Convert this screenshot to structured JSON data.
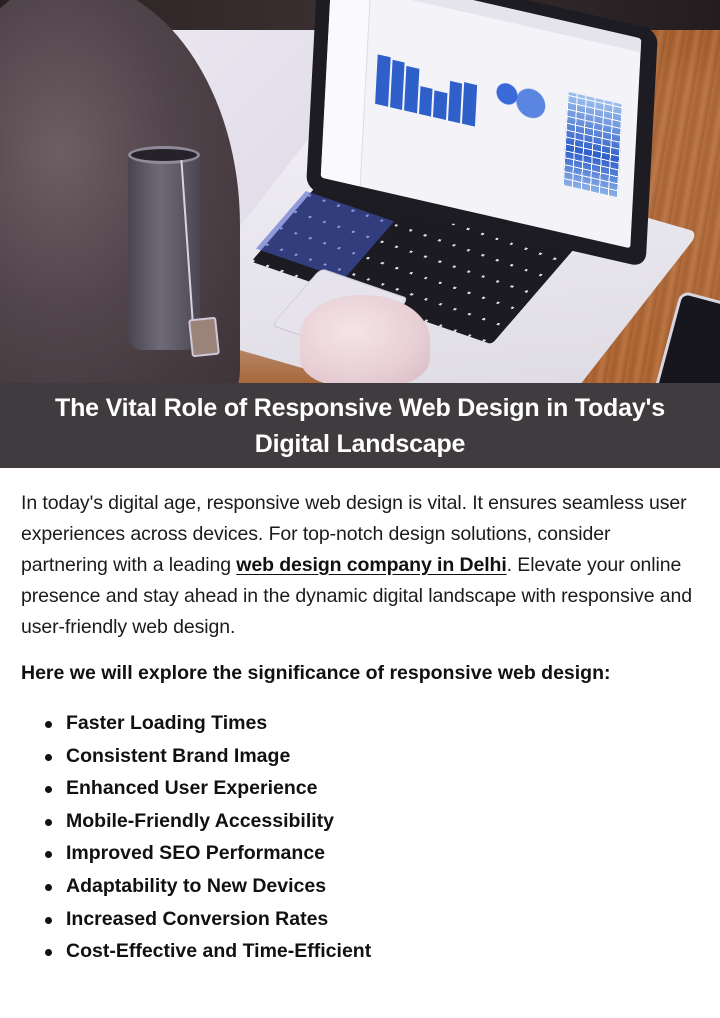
{
  "hero_image": {
    "alt": "Person using a laptop showing an analytics dashboard on a wooden desk, with a mug and a phone",
    "colors": {
      "accent_blue": "#2f5fc9",
      "desk_wood": "#a45e2e"
    }
  },
  "banner": {
    "title": "The Vital Role of Responsive Web Design in Today's Digital Landscape",
    "background": "#403b3e",
    "text_color": "#ffffff"
  },
  "intro": {
    "text_before_link": "In today's digital age, responsive web design is vital. It ensures seamless user experiences across devices. For top-notch design solutions, consider partnering with a leading ",
    "link_text": "web design company in Delhi",
    "text_after_link": ". Elevate your online presence and stay ahead in the dynamic digital landscape with responsive and user-friendly web design."
  },
  "lead": "Here we will explore the significance of responsive web design:",
  "benefits": [
    "Faster Loading Times",
    "Consistent Brand Image",
    "Enhanced User Experience",
    "Mobile-Friendly Accessibility",
    "Improved SEO Performance",
    "Adaptability to New Devices",
    "Increased Conversion Rates",
    "Cost-Effective and Time-Efficient"
  ]
}
